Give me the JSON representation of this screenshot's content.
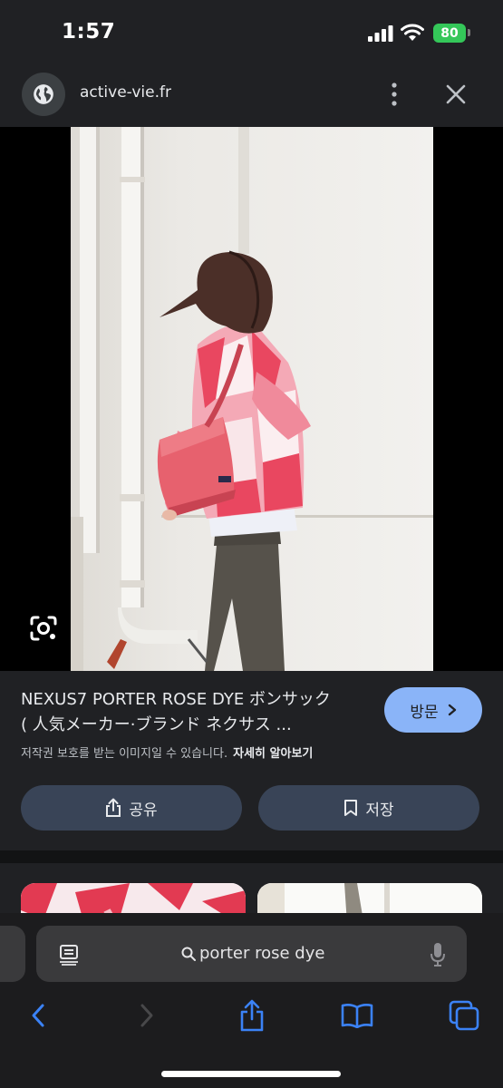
{
  "status_bar": {
    "time": "1:57",
    "battery": "80"
  },
  "header": {
    "domain": "active-vie.fr"
  },
  "result": {
    "title_line1": "NEXUS7 PORTER ROSE DYE ボンサック",
    "title_line2": "( 人気メーカー·ブランド ネクサス ...",
    "visit_label": "방문",
    "copyright_text": "저작권 보호를 받는 이미지일 수 있습니다.",
    "learn_more": "자세히 알아보기",
    "share_label": "공유",
    "save_label": "저장"
  },
  "search": {
    "query": "porter rose dye"
  },
  "colors": {
    "accent": "#8ab4f8",
    "panel": "#202124",
    "pill": "#394457",
    "ios_blue": "#3b82f6",
    "battery": "#34c759"
  },
  "icons": [
    "globe-icon",
    "more-vert-icon",
    "close-icon",
    "lens-icon",
    "share-icon",
    "bookmark-icon",
    "reader-icon",
    "search-icon",
    "mic-icon",
    "back-icon",
    "forward-icon",
    "book-icon",
    "tabs-icon"
  ]
}
